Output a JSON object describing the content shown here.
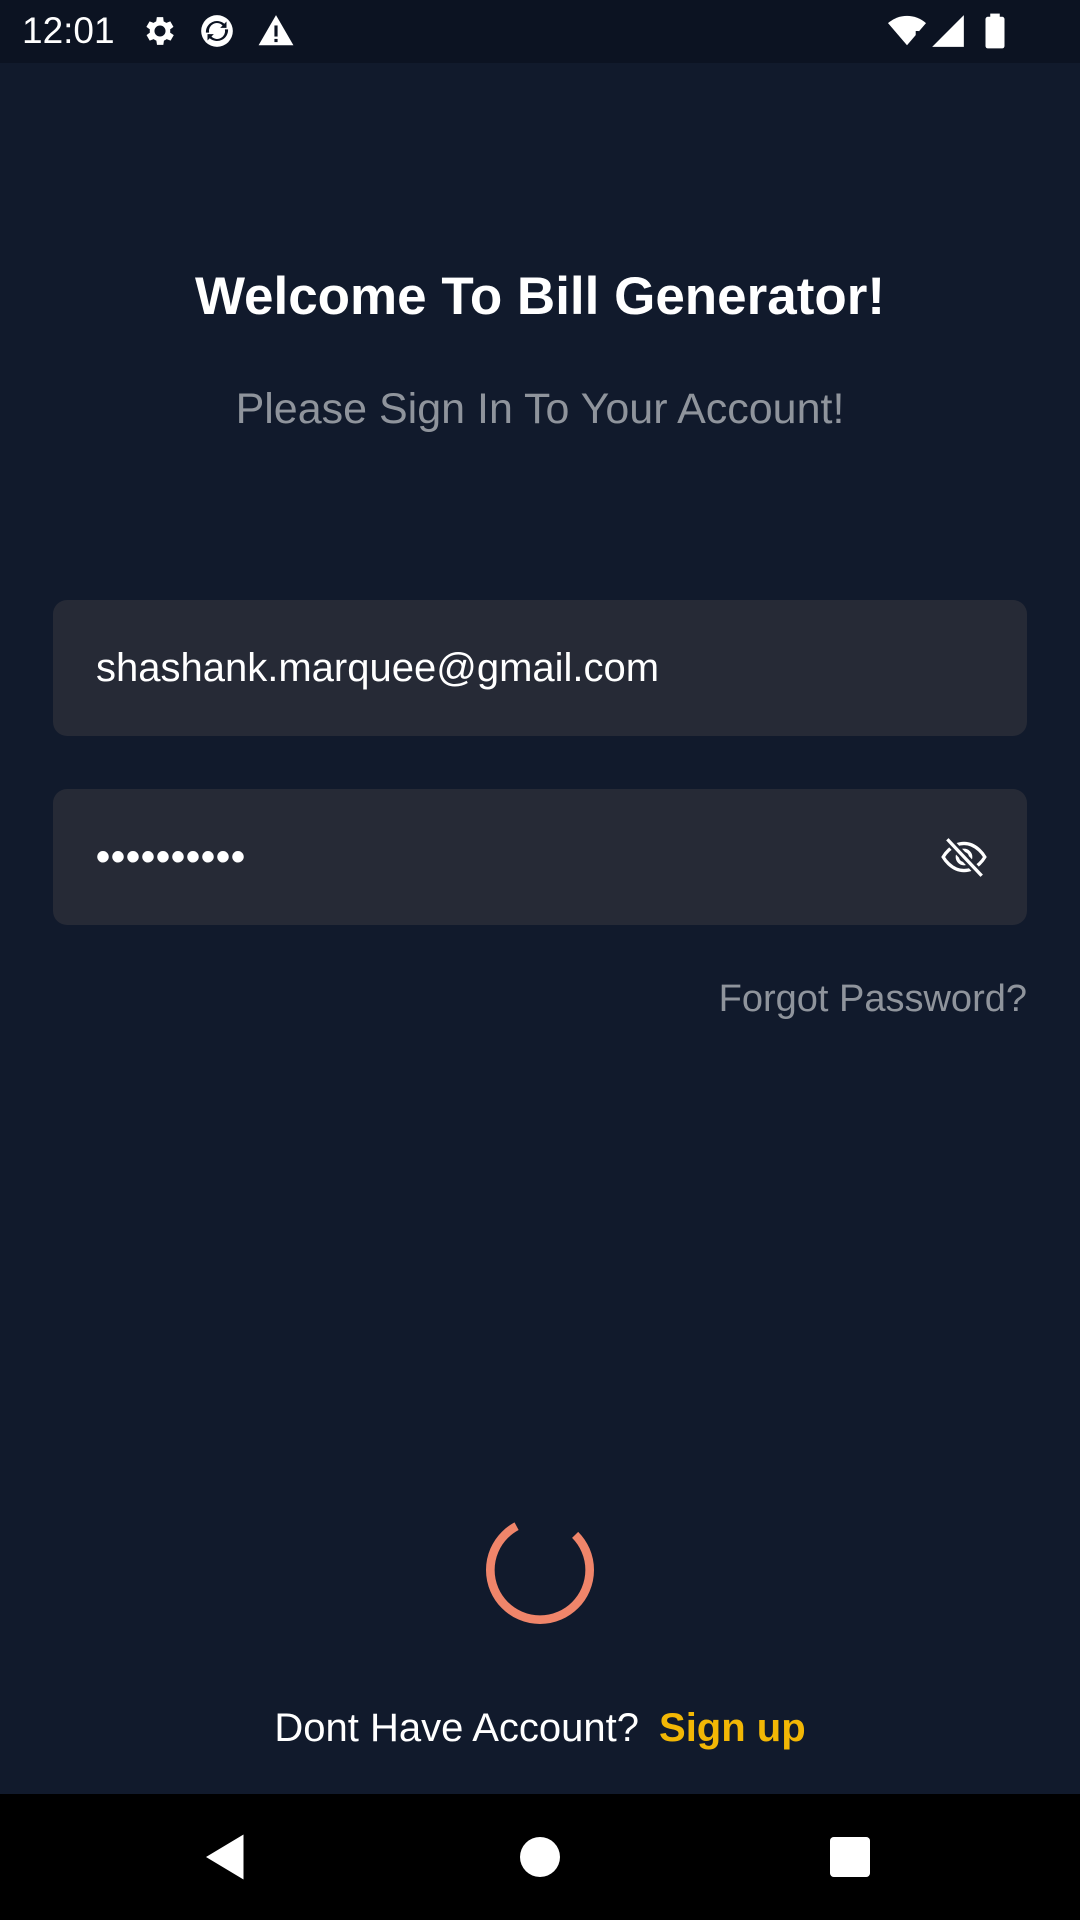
{
  "status_bar": {
    "time": "12:01",
    "icons": [
      "settings-gear-icon",
      "sync-app-icon",
      "warning-icon",
      "wifi-icon",
      "signal-icon",
      "battery-icon"
    ]
  },
  "login": {
    "title": "Welcome To Bill Generator!",
    "subtitle": "Please Sign In To Your Account!",
    "email_value": "shashank.marquee@gmail.com",
    "password_masked": "••••••••••",
    "password_toggle_icon": "eye-off-icon",
    "forgot_password": "Forgot Password?",
    "loading": true,
    "signup_prompt": "Dont Have Account?",
    "signup_link": "Sign up"
  },
  "colors": {
    "background": "#111a2c",
    "field_background": "#262a36",
    "muted_text": "#8f949c",
    "accent_link": "#f2b705",
    "spinner": "#f0856a"
  },
  "nav_bar": {
    "buttons": [
      "back-icon",
      "home-icon",
      "recents-icon"
    ]
  }
}
